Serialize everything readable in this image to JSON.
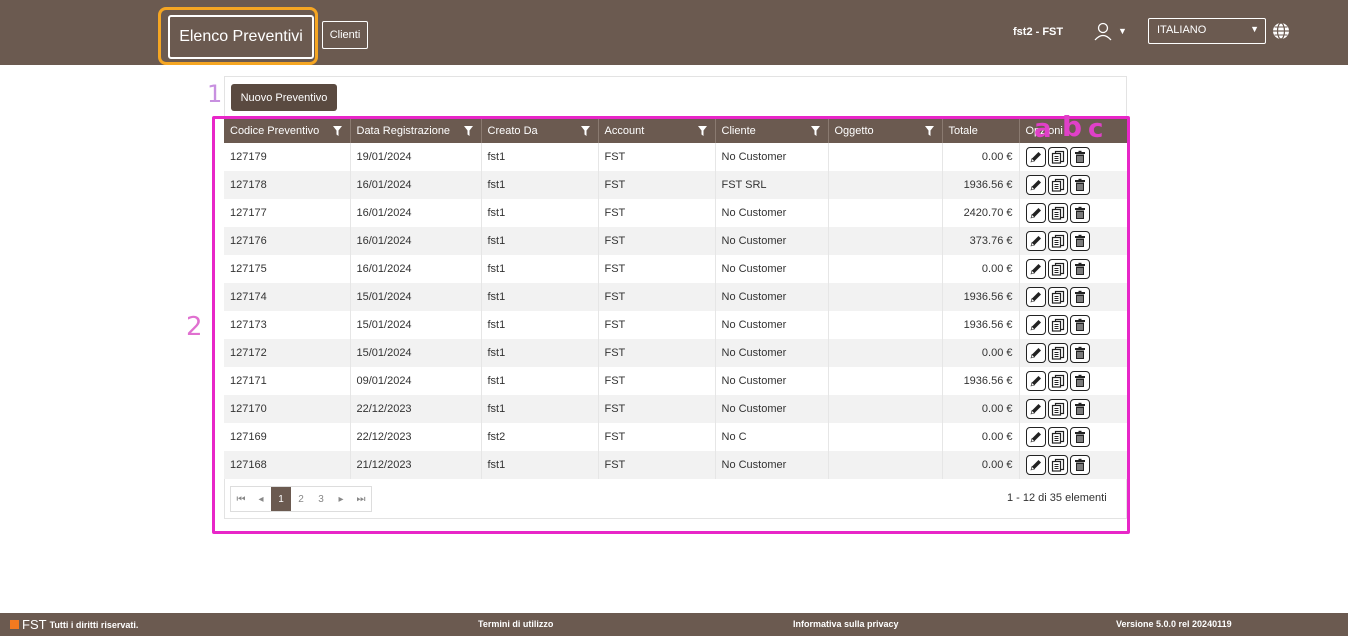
{
  "nav": {
    "active_label": "Elenco Preventivi",
    "clienti_label": "Clienti",
    "user_label": "fst2 - FST",
    "user_icon": "user-icon",
    "language": "ITALIANO",
    "globe_icon": "globe-icon",
    "highlight_color": "#f5a623"
  },
  "annotations": {
    "one": "1",
    "two": "2",
    "a": "a",
    "b": "b",
    "c": "c",
    "color": "#e826c8"
  },
  "toolbar": {
    "new_label": "Nuovo Preventivo"
  },
  "table": {
    "columns": [
      "Codice Preventivo",
      "Data Registrazione",
      "Creato Da",
      "Account",
      "Cliente",
      "Oggetto",
      "Totale",
      "Opzioni"
    ],
    "rows": [
      {
        "codice": "127179",
        "data": "19/01/2024",
        "creato": "fst1",
        "account": "FST",
        "cliente": "No Customer",
        "oggetto": "",
        "totale": "0.00 €"
      },
      {
        "codice": "127178",
        "data": "16/01/2024",
        "creato": "fst1",
        "account": "FST",
        "cliente": "FST SRL",
        "oggetto": "",
        "totale": "1936.56 €"
      },
      {
        "codice": "127177",
        "data": "16/01/2024",
        "creato": "fst1",
        "account": "FST",
        "cliente": "No Customer",
        "oggetto": "",
        "totale": "2420.70 €"
      },
      {
        "codice": "127176",
        "data": "16/01/2024",
        "creato": "fst1",
        "account": "FST",
        "cliente": "No Customer",
        "oggetto": "",
        "totale": "373.76 €"
      },
      {
        "codice": "127175",
        "data": "16/01/2024",
        "creato": "fst1",
        "account": "FST",
        "cliente": "No Customer",
        "oggetto": "",
        "totale": "0.00 €"
      },
      {
        "codice": "127174",
        "data": "15/01/2024",
        "creato": "fst1",
        "account": "FST",
        "cliente": "No Customer",
        "oggetto": "",
        "totale": "1936.56 €"
      },
      {
        "codice": "127173",
        "data": "15/01/2024",
        "creato": "fst1",
        "account": "FST",
        "cliente": "No Customer",
        "oggetto": "",
        "totale": "1936.56 €"
      },
      {
        "codice": "127172",
        "data": "15/01/2024",
        "creato": "fst1",
        "account": "FST",
        "cliente": "No Customer",
        "oggetto": "",
        "totale": "0.00 €"
      },
      {
        "codice": "127171",
        "data": "09/01/2024",
        "creato": "fst1",
        "account": "FST",
        "cliente": "No Customer",
        "oggetto": "",
        "totale": "1936.56 €"
      },
      {
        "codice": "127170",
        "data": "22/12/2023",
        "creato": "fst1",
        "account": "FST",
        "cliente": "No Customer",
        "oggetto": "",
        "totale": "0.00 €"
      },
      {
        "codice": "127169",
        "data": "22/12/2023",
        "creato": "fst2",
        "account": "FST",
        "cliente": "No C",
        "oggetto": "",
        "totale": "0.00 €"
      },
      {
        "codice": "127168",
        "data": "21/12/2023",
        "creato": "fst1",
        "account": "FST",
        "cliente": "No Customer",
        "oggetto": "",
        "totale": "0.00 €"
      }
    ],
    "row_actions": [
      "edit-icon",
      "copy-icon",
      "delete-icon"
    ]
  },
  "pager": {
    "first": "⏮",
    "prev": "◂",
    "pages": [
      "1",
      "2",
      "3"
    ],
    "current": "1",
    "next": "▸",
    "last": "⏭",
    "info": "1 - 12 di 35 elementi"
  },
  "footer": {
    "brand": "FST",
    "rights": "Tutti i diritti riservati.",
    "terms": "Termini di utilizzo",
    "privacy": "Informativa sulla privacy",
    "version": "Versione 5.0.0 rel 20240119"
  }
}
